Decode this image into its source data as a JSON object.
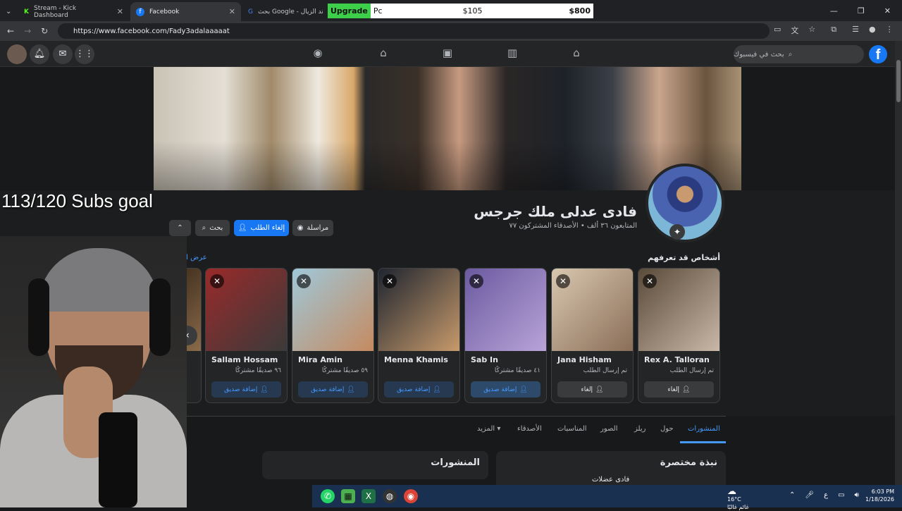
{
  "browser": {
    "tabs": [
      {
        "title": "Stream - Kick Dashboard",
        "icon": "kick-icon"
      },
      {
        "title": "Facebook",
        "icon": "facebook-icon"
      },
      {
        "title": "بحث Google - ند الزيال",
        "icon": "google-icon"
      }
    ],
    "url": "https://www.facebook.com/Fady3adalaaaaat"
  },
  "overlay": {
    "upgrade_label": "Upgrade",
    "upgrade_suffix": "Pc",
    "price_1": "$105",
    "price_2": "$800",
    "subs_goal": "113/120 Subs goal"
  },
  "fb": {
    "search_placeholder": "بحث في فيسبوك",
    "logo": "f"
  },
  "profile": {
    "name": "فادى عدلى ملك جرجس",
    "stats": "المتابعون ٣٦ ألف • الأصدقاء المشتركون ٧٧",
    "message_label": "مراسلة",
    "cancel_request_label": "إلغاء الطلب",
    "search_label": "بحث",
    "more_label": "⌃"
  },
  "suggestions": {
    "title": "أشخاص قد تعرفهم",
    "see_all": "عرض الكل",
    "cards": [
      {
        "name": "Rex A. Talloran",
        "sub": "تم إرسال الطلب",
        "button": "إلغاء",
        "type": "cancel",
        "colors": [
          "#5a4a3a",
          "#c9b8a8"
        ]
      },
      {
        "name": "Jana Hisham",
        "sub": "تم إرسال الطلب",
        "button": "إلغاء",
        "type": "cancel",
        "colors": [
          "#d9c7b0",
          "#8a6e58"
        ]
      },
      {
        "name": "Sab In",
        "sub": "٤١ صديقًا مشتركًا",
        "button": "إضافة صديق",
        "type": "add",
        "colors": [
          "#6a5aa0",
          "#b9a3d8"
        ]
      },
      {
        "name": "Menna Khamis",
        "sub": "",
        "button": "إضافة صديق",
        "type": "add",
        "colors": [
          "#1f2530",
          "#c79a6b"
        ]
      },
      {
        "name": "Mira Amin",
        "sub": "٥٩ صديقًا مشتركًا",
        "button": "إضافة صديق",
        "type": "add",
        "colors": [
          "#9fc8d9",
          "#c58a60"
        ]
      },
      {
        "name": "Sallam Hossam",
        "sub": "٩٦ صديقًا مشتركًا",
        "button": "إضافة صديق",
        "type": "add",
        "colors": [
          "#9a2a2a",
          "#3a3a3a"
        ]
      }
    ]
  },
  "profile_tabs": [
    "المنشورات",
    "حول",
    "ريلز",
    "الصور",
    "المناسبات",
    "الأصدقاء",
    "المزيد ▾"
  ],
  "sections": {
    "posts_title": "المنشورات",
    "intro_title": "نبذة مختصرة",
    "intro_line": "فادى عضلات"
  },
  "taskbar": {
    "temperature": "16°C",
    "weather_desc": "غائم غالبًا",
    "time": "6:03 PM",
    "date": "1/18/2026",
    "lang": "ع"
  }
}
